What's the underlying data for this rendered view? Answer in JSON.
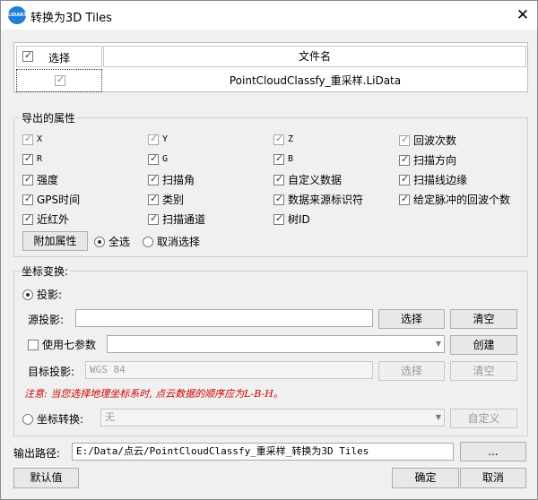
{
  "window": {
    "title": "转换为3D Tiles",
    "logo_text": "LIDAR360"
  },
  "file_grid": {
    "headers": {
      "select": "选择",
      "filename": "文件名"
    },
    "rows": [
      {
        "checked": true,
        "filename": "PointCloudClassfy_重采样.LiData"
      }
    ]
  },
  "attributes": {
    "legend": "导出的属性",
    "items": [
      {
        "label": "X",
        "checked": true,
        "enabled": false
      },
      {
        "label": "Y",
        "checked": true,
        "enabled": false
      },
      {
        "label": "Z",
        "checked": true,
        "enabled": false
      },
      {
        "label": "回波次数",
        "checked": true,
        "enabled": false
      },
      {
        "label": "R",
        "checked": true,
        "enabled": true
      },
      {
        "label": "G",
        "checked": true,
        "enabled": true
      },
      {
        "label": "B",
        "checked": true,
        "enabled": true
      },
      {
        "label": "扫描方向",
        "checked": true,
        "enabled": true
      },
      {
        "label": "强度",
        "checked": true,
        "enabled": true
      },
      {
        "label": "扫描角",
        "checked": true,
        "enabled": true
      },
      {
        "label": "自定义数据",
        "checked": true,
        "enabled": true
      },
      {
        "label": "扫描线边缘",
        "checked": true,
        "enabled": true
      },
      {
        "label": "GPS时间",
        "checked": true,
        "enabled": true
      },
      {
        "label": "类别",
        "checked": true,
        "enabled": true
      },
      {
        "label": "数据来源标识符",
        "checked": true,
        "enabled": true
      },
      {
        "label": "给定脉冲的回波个数",
        "checked": true,
        "enabled": true
      },
      {
        "label": "近红外",
        "checked": true,
        "enabled": true
      },
      {
        "label": "扫描通道",
        "checked": true,
        "enabled": true
      },
      {
        "label": "树ID",
        "checked": true,
        "enabled": true
      }
    ],
    "add_button": "附加属性",
    "select_all": "全选",
    "deselect": "取消选择"
  },
  "coord": {
    "legend": "坐标变换:",
    "projection_label": "投影:",
    "source_label": "源投影:",
    "source_value": "",
    "select_button": "选择",
    "clear_button": "清空",
    "seven_param_label": "使用七参数",
    "seven_param_value": "",
    "create_button": "创建",
    "target_label": "目标投影:",
    "target_value": "WGS 84",
    "target_select_button": "选择",
    "target_clear_button": "清空",
    "note": "注意: 当您选择地理坐标系时, 点云数据的顺序应为L-B-H。",
    "transform_label": "坐标转换:",
    "transform_value": "无",
    "custom_button": "自定义"
  },
  "output": {
    "label": "输出路径:",
    "path": "E:/Data/点云/PointCloudClassfy_重采样_转换为3D Tiles",
    "browse_button": "..."
  },
  "footer": {
    "default_button": "默认值",
    "ok_button": "确定",
    "cancel_button": "取消"
  }
}
